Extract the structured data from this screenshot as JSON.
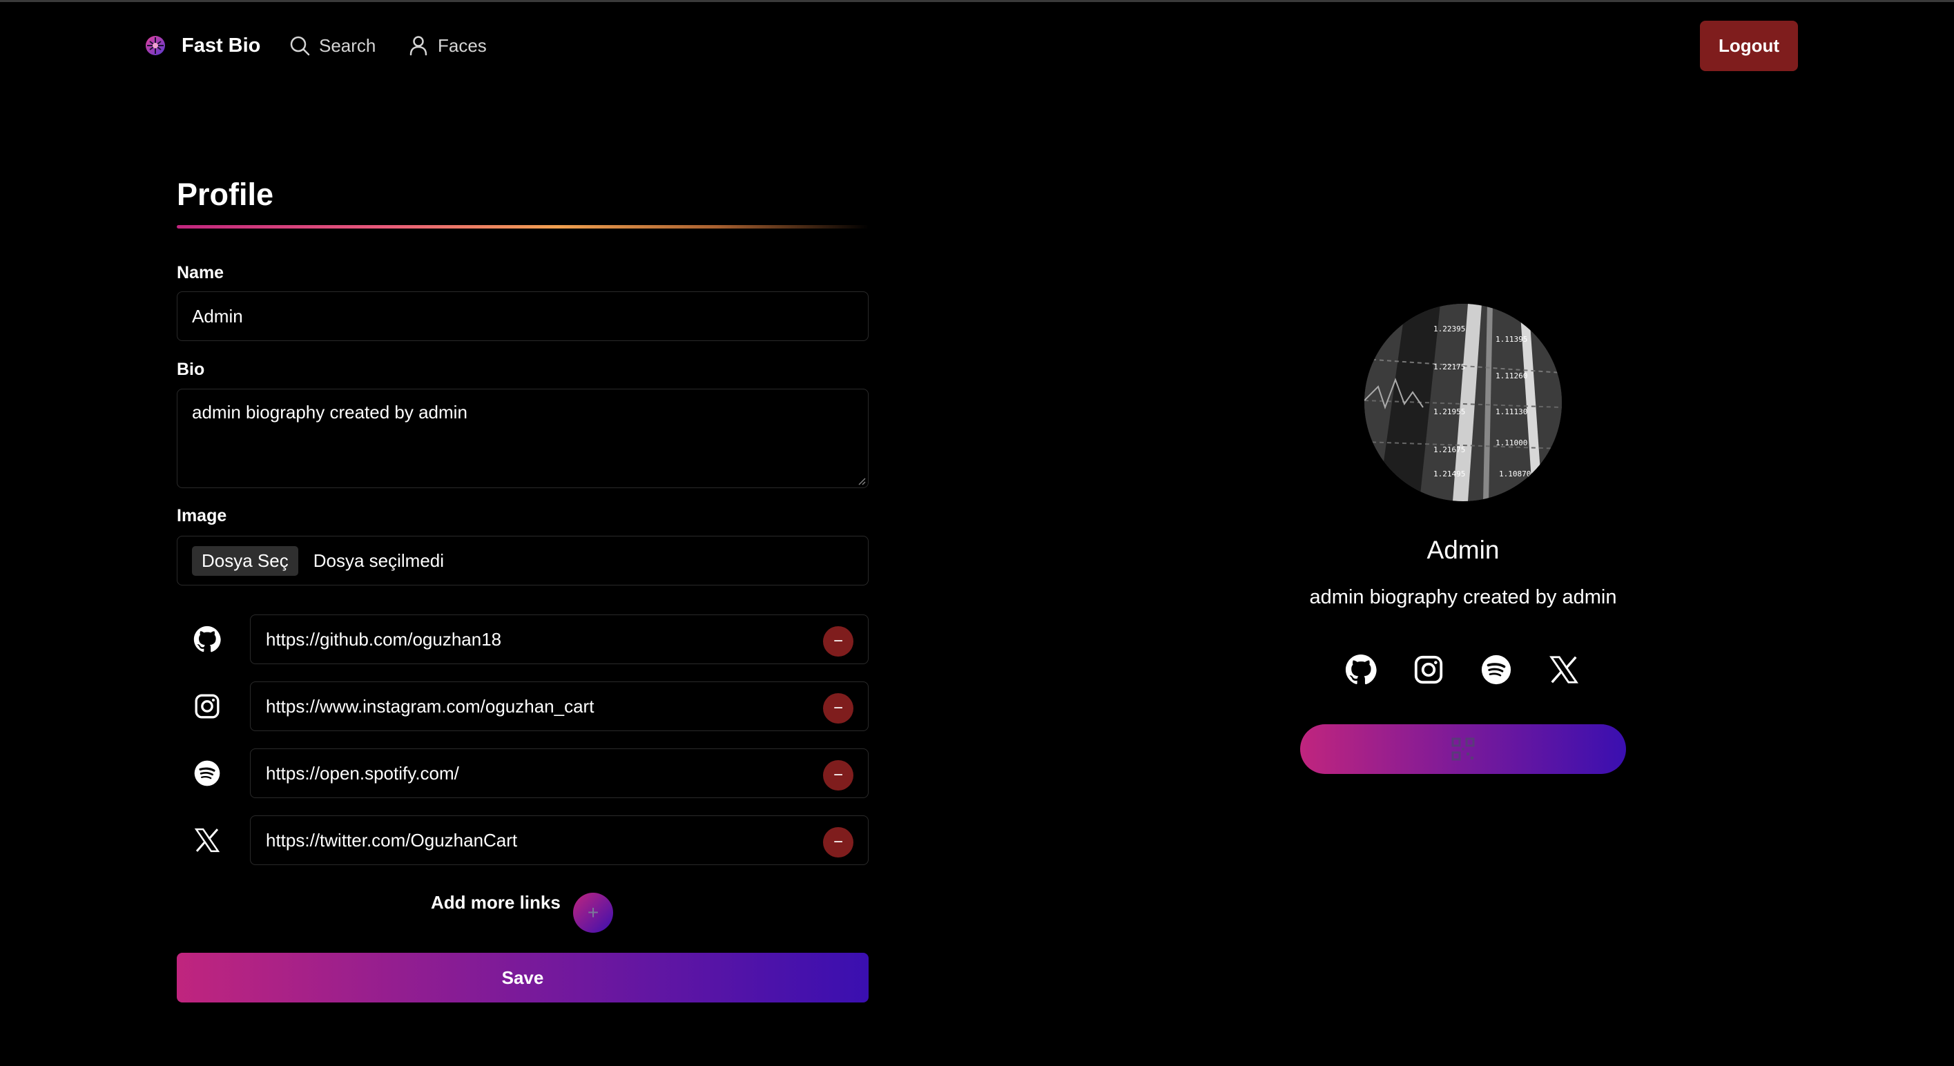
{
  "header": {
    "brand": "Fast Bio",
    "nav": [
      {
        "label": "Search",
        "icon": "search-icon"
      },
      {
        "label": "Faces",
        "icon": "user-icon"
      }
    ],
    "logout_label": "Logout"
  },
  "form": {
    "title": "Profile",
    "name_label": "Name",
    "name_value": "Admin",
    "bio_label": "Bio",
    "bio_value": "admin biography created by admin",
    "image_label": "Image",
    "file_button": "Dosya Seç",
    "file_status": "Dosya seçilmedi",
    "links": [
      {
        "icon": "github-icon",
        "url": "https://github.com/oguzhan18"
      },
      {
        "icon": "instagram-icon",
        "url": "https://www.instagram.com/oguzhan_cart"
      },
      {
        "icon": "spotify-icon",
        "url": "https://open.spotify.com/"
      },
      {
        "icon": "x-twitter-icon",
        "url": "https://twitter.com/OguzhanCart"
      }
    ],
    "remove_symbol": "−",
    "add_more_label": "Add more links",
    "add_symbol": "+",
    "save_label": "Save"
  },
  "preview": {
    "name": "Admin",
    "bio": "admin biography created by admin",
    "socials": [
      "github-icon",
      "instagram-icon",
      "spotify-icon",
      "x-twitter-icon"
    ],
    "qr_icon": "qr-code-icon"
  },
  "colors": {
    "background": "#000000",
    "danger": "#7f1d1d",
    "gradient_start": "#c0257e",
    "gradient_end": "#3a0fb0"
  }
}
